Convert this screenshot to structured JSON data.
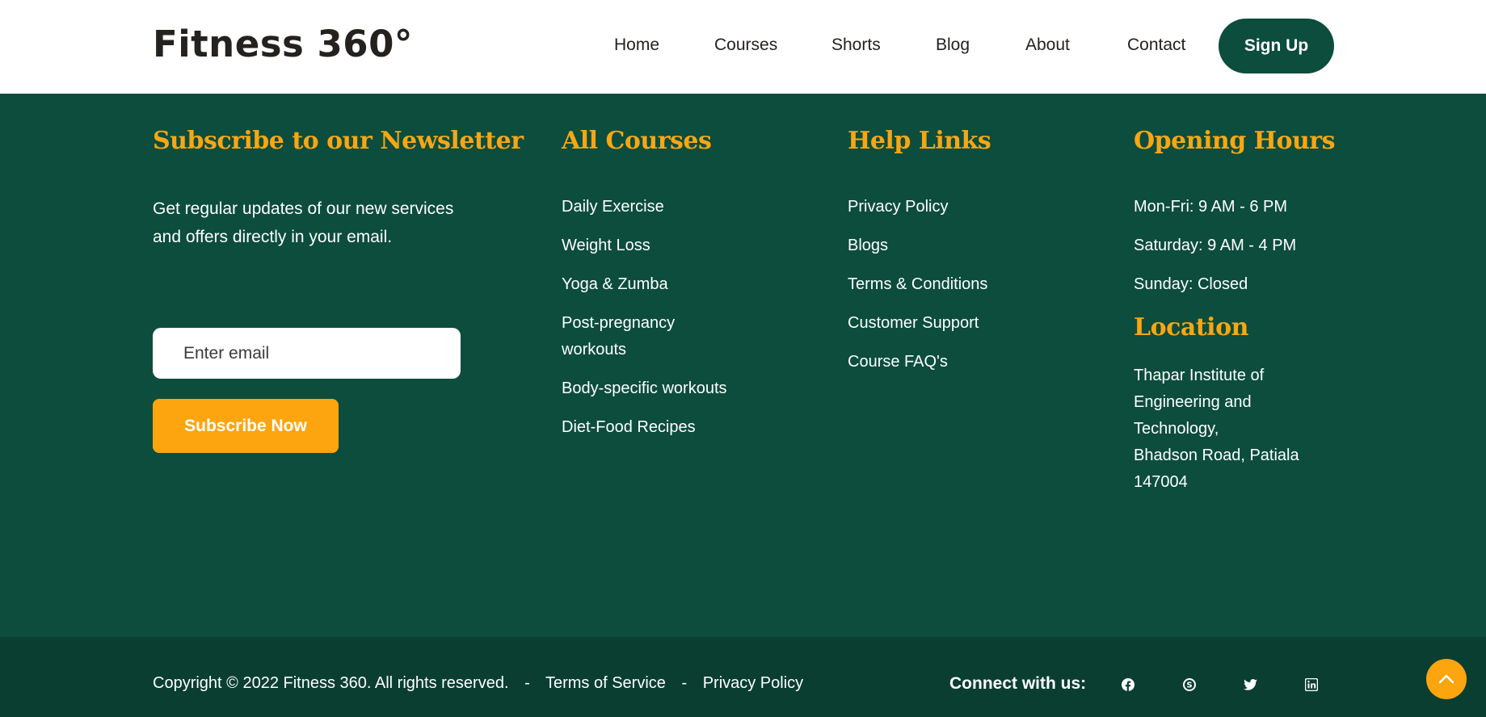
{
  "header": {
    "logo": "Fitness 360°",
    "nav": [
      "Home",
      "Courses",
      "Shorts",
      "Blog",
      "About",
      "Contact"
    ],
    "signup_label": "Sign Up"
  },
  "newsletter": {
    "title": "Subscribe to our Newsletter",
    "text": "Get regular updates of our new services and offers directly in your email.",
    "email_placeholder": "Enter email",
    "button_label": "Subscribe Now"
  },
  "courses": {
    "title": "All Courses",
    "items": [
      "Daily Exercise",
      "Weight Loss",
      "Yoga & Zumba",
      "Post-pregnancy workouts",
      "Body-specific workouts",
      "Diet-Food Recipes"
    ]
  },
  "help": {
    "title": "Help Links",
    "items": [
      "Privacy Policy",
      "Blogs",
      "Terms & Conditions",
      "Customer Support",
      "Course FAQ's"
    ]
  },
  "hours": {
    "title": "Opening Hours",
    "items": [
      "Mon-Fri: 9 AM - 6 PM",
      "Saturday: 9 AM - 4 PM",
      "Sunday: Closed"
    ]
  },
  "location": {
    "title": "Location",
    "address_line1": "Thapar Institute of Engineering and Technology,",
    "address_line2": "Bhadson Road, Patiala 147004"
  },
  "footer": {
    "copyright": "Copyright © 2022 Fitness 360. All rights reserved.",
    "separator": "-",
    "terms": "Terms of Service",
    "privacy": "Privacy Policy",
    "connect": "Connect with us:",
    "social_icons": [
      "facebook-icon",
      "skype-icon",
      "twitter-icon",
      "linkedin-icon"
    ]
  },
  "colors": {
    "primary": "#0c4d3d",
    "footer_bar": "#0a3e31",
    "accent": "#fca50f",
    "heading": "#f8a614"
  }
}
